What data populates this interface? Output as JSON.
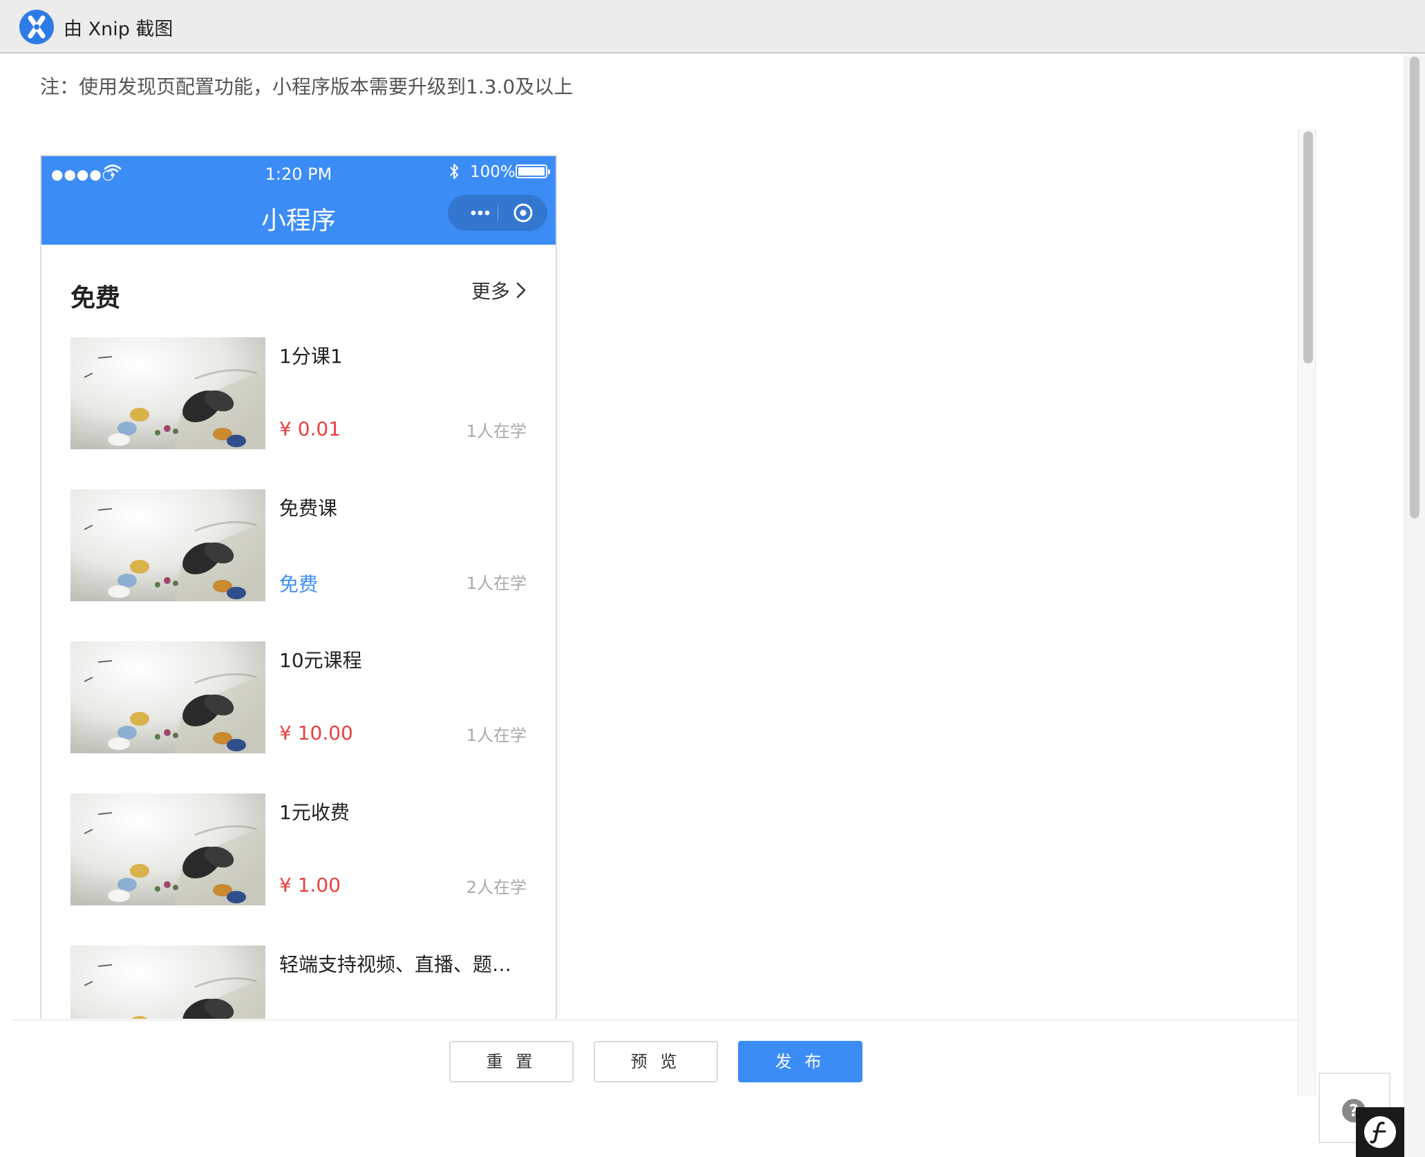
{
  "window": {
    "title": "由 Xnip 截图"
  },
  "notice": "注：使用发现页配置功能，小程序版本需要升级到1.3.0及以上",
  "phone": {
    "status_bar": {
      "signal": "●●●●○",
      "time": "1:20 PM",
      "battery": "100%"
    },
    "nav_title": "小程序"
  },
  "section": {
    "title": "免费",
    "more_label": "更多"
  },
  "courses": [
    {
      "title": "1分课1",
      "price": "¥ 0.01",
      "price_color": "#e8413f",
      "learners": "1人在学"
    },
    {
      "title": "免费课",
      "price": "免费",
      "price_color": "#3c8cf6",
      "learners": "1人在学"
    },
    {
      "title": "10元课程",
      "price": "¥ 10.00",
      "price_color": "#e8413f",
      "learners": "1人在学"
    },
    {
      "title": "1元收费",
      "price": "¥ 1.00",
      "price_color": "#e8413f",
      "learners": "2人在学"
    },
    {
      "title": "轻端支持视频、直播、题…",
      "price": "",
      "price_color": "#e8413f",
      "learners": ""
    }
  ],
  "buttons": {
    "reset": "重 置",
    "preview": "预 览",
    "publish": "发 布"
  },
  "help": {
    "label": "?"
  },
  "colors": {
    "accent": "#3c8cf6",
    "price_red": "#e8413f",
    "muted": "#aaaaaa"
  }
}
